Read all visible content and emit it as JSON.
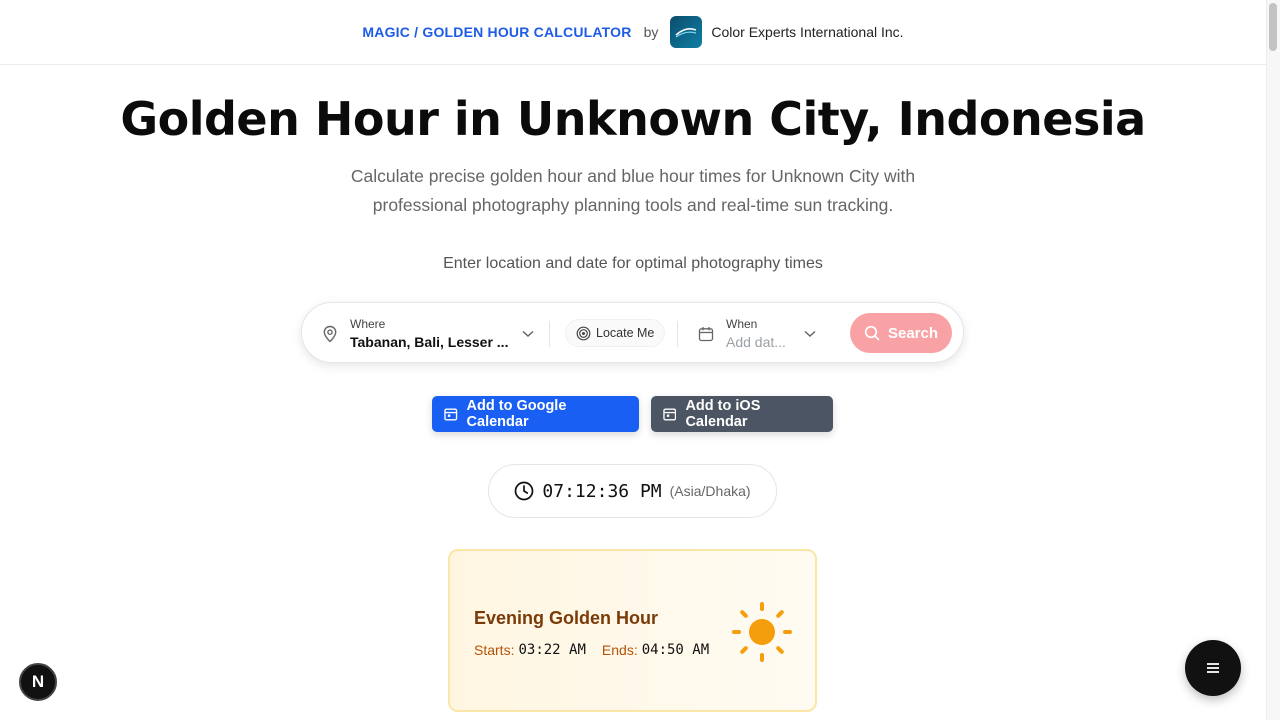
{
  "header": {
    "breadcrumb": "MAGIC / GOLDEN HOUR CALCULATOR",
    "by": "by",
    "brand": "Color Experts International Inc."
  },
  "hero": {
    "title": "Golden Hour in Unknown City, Indonesia",
    "subtitle_line1": "Calculate precise golden hour and blue hour times for Unknown City with",
    "subtitle_line2": "professional photography planning tools and real-time sun tracking.",
    "prompt": "Enter location and date for optimal photography times"
  },
  "search": {
    "where_label": "Where",
    "where_value": "Tabanan, Bali, Lesser ...",
    "locate_label": "Locate Me",
    "when_label": "When",
    "when_placeholder": "Add dat...",
    "search_label": "Search"
  },
  "calendar": {
    "google_label": "Add to Google Calendar",
    "ios_label": "Add to iOS Calendar"
  },
  "clock": {
    "time": "07:12:36 PM",
    "timezone": "(Asia/Dhaka)"
  },
  "golden_card": {
    "title": "Evening Golden Hour",
    "starts_label": "Starts:",
    "starts_value": "03:22 AM",
    "ends_label": "Ends:",
    "ends_value": "04:50 AM"
  },
  "badges": {
    "nextjs": "N"
  },
  "colors": {
    "accent_blue": "#1a5ff3",
    "search_button": "#f9a2a6",
    "ios_button": "#4b5563",
    "golden_border": "#fae7a7",
    "golden_title": "#7a3a08",
    "sun": "#f59e0b"
  },
  "icons": {
    "location": "map-pin-icon",
    "locate": "target-icon",
    "when": "calendar-icon",
    "chevron": "chevron-down-icon",
    "search": "search-icon",
    "clock": "clock-icon",
    "sun": "sun-icon",
    "menu": "menu-icon"
  }
}
